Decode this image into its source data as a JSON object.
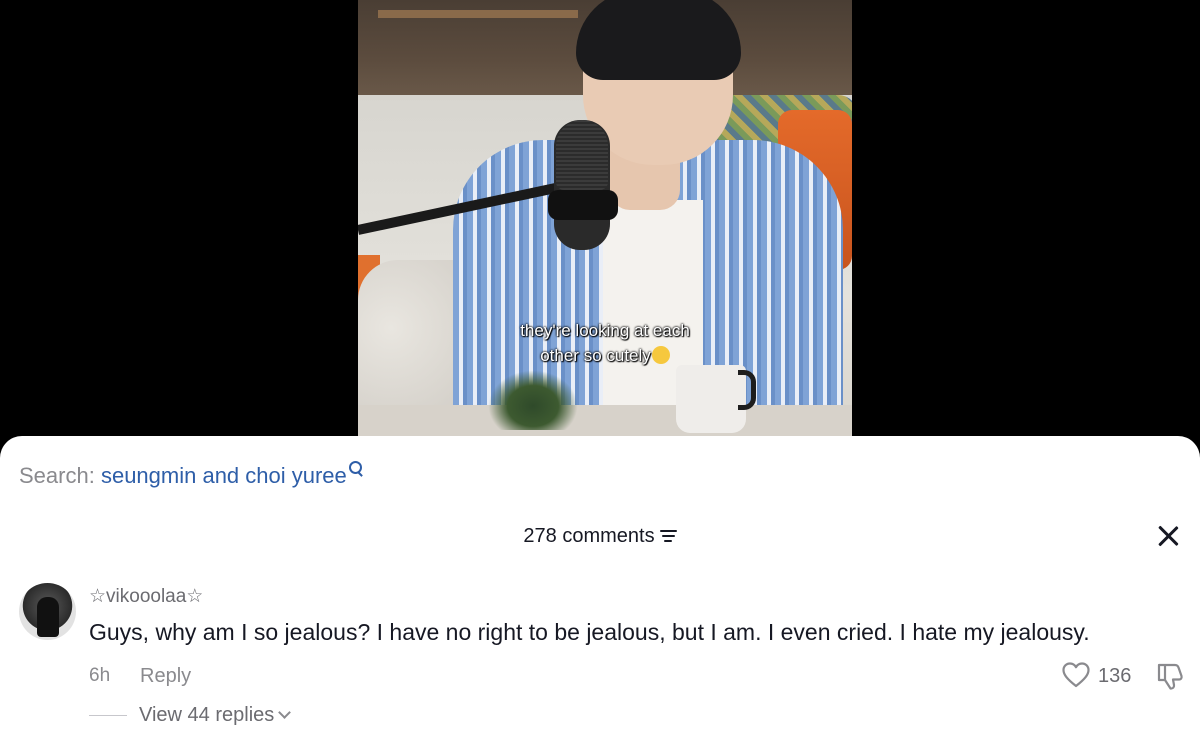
{
  "video": {
    "caption_line1": "they're looking at each",
    "caption_line2": "other so cutely",
    "caption_emoji": "pleading-face-emoji"
  },
  "search": {
    "label": "Search:",
    "query": "seungmin and choi yuree"
  },
  "comments": {
    "header": "278 comments",
    "items": [
      {
        "username": "☆vikooolaa☆",
        "text": "Guys, why am I so jealous? I have no right to be jealous, but I am. I even cried. I hate my jealousy.",
        "time": "6h",
        "reply_label": "Reply",
        "like_count": "136",
        "view_replies_label": "View 44 replies"
      }
    ]
  },
  "colors": {
    "link_blue": "#2e5ea8",
    "text_primary": "#161823",
    "text_secondary": "#8a8a8e"
  }
}
